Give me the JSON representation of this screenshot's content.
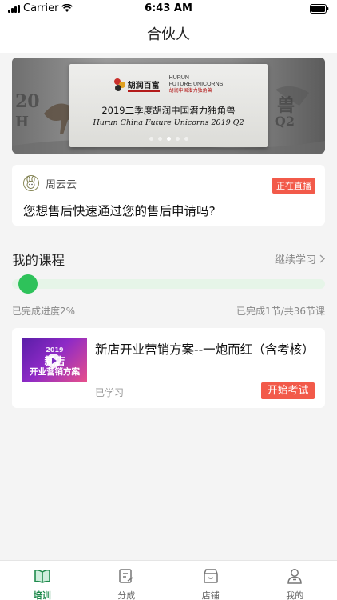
{
  "status_bar": {
    "carrier": "Carrier",
    "time": "6:43 AM"
  },
  "nav": {
    "title": "合伙人"
  },
  "banner": {
    "logo_cn": "胡润百富",
    "logo_en_line1": "HURUN",
    "logo_en_line2": "FUTURE UNICORNS",
    "logo_en_line3": "胡润中国潜力独角兽",
    "title_cn": "2019二季度胡润中国潜力独角兽",
    "title_en": "Hurun China Future Unicorns 2019 Q2",
    "left_ghost": "20",
    "left_ghost_2": "H",
    "right_ghost": "兽",
    "right_ghost_2": "Q2",
    "dot_count": 5,
    "active_dot": 2
  },
  "live": {
    "host": "周云云",
    "badge": "正在直播",
    "question": "您想售后快速通过您的售后申请吗?"
  },
  "courses": {
    "title": "我的课程",
    "continue_label": "继续学习",
    "progress_fraction": 0.02,
    "progress_text": "已完成进度2%",
    "count_text": "已完成1节/共36节课"
  },
  "lesson": {
    "thumb_year": "2019",
    "thumb_line1": "新店",
    "thumb_line2": "开业营销方案",
    "name": "新店开业营销方案--一炮而红（含考核）",
    "status": "已学习",
    "exam_label": "开始考试"
  },
  "tabs": [
    {
      "label": "培训",
      "icon": "book-icon",
      "active": true
    },
    {
      "label": "分成",
      "icon": "share-icon",
      "active": false
    },
    {
      "label": "店铺",
      "icon": "store-icon",
      "active": false
    },
    {
      "label": "我的",
      "icon": "user-icon",
      "active": false
    }
  ],
  "colors": {
    "accent_green": "#2ec25a",
    "tab_active": "#1f8a4c",
    "badge_red": "#f25a4a"
  }
}
